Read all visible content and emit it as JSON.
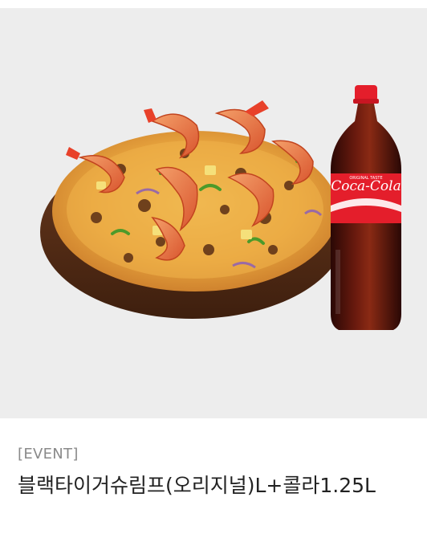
{
  "product": {
    "tag": "[EVENT]",
    "name": "블랙타이거슈림프(오리지널)L+콜라1.25L",
    "image_label": "Coca-Cola",
    "image_sublabel": "ORIGINAL TASTE"
  },
  "colors": {
    "image_background": "#ededed",
    "tag_text": "#8a8a8a",
    "title_text": "#222222",
    "coke_red": "#e41e2b"
  }
}
